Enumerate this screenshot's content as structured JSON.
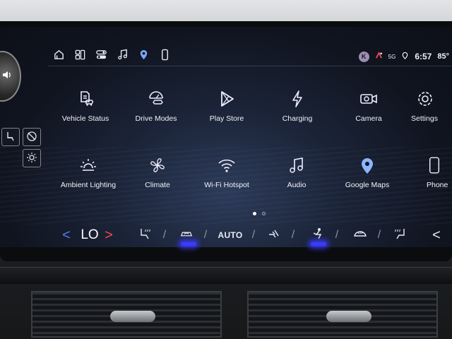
{
  "top_bar": {
    "shortcuts": [
      {
        "icon": "home-icon"
      },
      {
        "icon": "apps-grid-icon"
      },
      {
        "icon": "toggles-icon"
      },
      {
        "icon": "music-note-icon"
      },
      {
        "icon": "map-pin-icon",
        "active": true
      },
      {
        "icon": "phone-icon"
      }
    ],
    "status": {
      "profile_initial": "K",
      "network": "5G",
      "time": "6:57",
      "temperature": "85°"
    }
  },
  "apps": [
    {
      "label": "Vehicle Status",
      "icon": "vehicle-status-icon"
    },
    {
      "label": "Drive Modes",
      "icon": "drive-modes-icon"
    },
    {
      "label": "Play Store",
      "icon": "play-store-icon"
    },
    {
      "label": "Charging",
      "icon": "charging-icon"
    },
    {
      "label": "Camera",
      "icon": "camera-icon"
    },
    {
      "label": "Settings",
      "icon": "gear-icon"
    },
    {
      "label": "Ambient Lighting",
      "icon": "ambient-lighting-icon"
    },
    {
      "label": "Climate",
      "icon": "fan-icon"
    },
    {
      "label": "Wi-Fi Hotspot",
      "icon": "wifi-icon"
    },
    {
      "label": "Audio",
      "icon": "music-note-icon"
    },
    {
      "label": "Google Maps",
      "icon": "google-maps-icon"
    },
    {
      "label": "Phone",
      "icon": "phone-icon"
    }
  ],
  "pager": {
    "pages": 2,
    "current": 1
  },
  "climate": {
    "temp_left": "LO",
    "chevron_left": "<",
    "chevron_right": ">",
    "auto_label": "AUTO",
    "separator": "/",
    "chevron_far_right": "<"
  }
}
